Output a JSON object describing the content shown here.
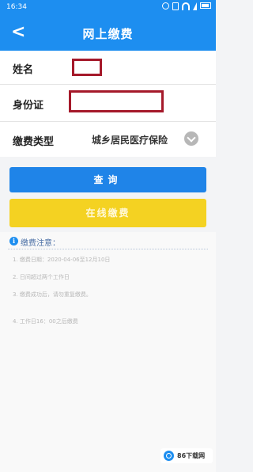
{
  "status_bar": {
    "time": "16:34"
  },
  "header": {
    "back": "<",
    "title": "网上缴费"
  },
  "form": {
    "name_label": "姓名",
    "id_label": "身份证",
    "type_label": "缴费类型",
    "type_value": "城乡居民医疗保险"
  },
  "buttons": {
    "query": "查询",
    "pay": "在线缴费"
  },
  "notice": {
    "title": "缴费注意：",
    "items": [
      {
        "number": "1.",
        "text": "缴费日期：2020-04-06至12月10日"
      },
      {
        "number": "2.",
        "text": "日间超过两个工作日"
      },
      {
        "number": "3.",
        "text": "缴费成功后，请勿重复缴费。"
      },
      {
        "number": "4.",
        "text": "工作日16：00之后缴费"
      }
    ]
  },
  "watermark": {
    "text": "86下载网"
  },
  "colors": {
    "primary": "#1d8ef0",
    "query_button": "#1f84e8",
    "pay_button": "#f4d222",
    "redaction": "#a5192a"
  }
}
